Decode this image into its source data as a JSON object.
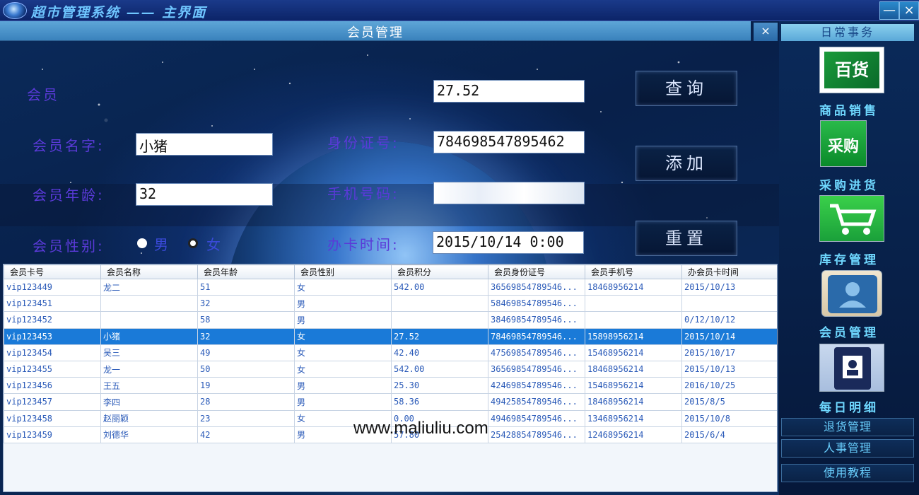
{
  "window": {
    "title": "超市管理系统 —— 主界面",
    "minimize": "—",
    "close": "×"
  },
  "panel": {
    "title": "会员管理",
    "close": "×"
  },
  "form": {
    "member_label": "会员",
    "member_value": "27.52",
    "name_label": "会员名字:",
    "name_value": "小猪",
    "id_label": "身份证号:",
    "id_value": "784698547895462",
    "age_label": "会员年龄:",
    "age_value": "32",
    "phone_label": "手机号码:",
    "phone_value": "",
    "gender_label": "会员性别:",
    "gender_male": "男",
    "gender_female": "女",
    "gender_selected": "男",
    "date_label": "办卡时间:",
    "date_value": "2015/10/14 0:00"
  },
  "buttons": {
    "query": "查询",
    "add": "添加",
    "reset": "重置"
  },
  "table": {
    "columns": [
      "会员卡号",
      "会员名称",
      "会员年龄",
      "会员性别",
      "会员积分",
      "会员身份证号",
      "会员手机号",
      "办会员卡时间"
    ],
    "selected_row": 3,
    "rows": [
      [
        "vip123449",
        "龙二",
        "51",
        "女",
        "542.00",
        "36569854789546...",
        "18468956214",
        "2015/10/13"
      ],
      [
        "vip123451",
        "",
        "32",
        "男",
        "",
        "58469854789546...",
        "",
        ""
      ],
      [
        "vip123452",
        "",
        "58",
        "男",
        "",
        "38469854789546...",
        "",
        "0/12/10/12"
      ],
      [
        "vip123453",
        "小猪",
        "32",
        "女",
        "27.52",
        "78469854789546...",
        "15898956214",
        "2015/10/14"
      ],
      [
        "vip123454",
        "吴三",
        "49",
        "女",
        "42.40",
        "47569854789546...",
        "15468956214",
        "2015/10/17"
      ],
      [
        "vip123455",
        "龙一",
        "50",
        "女",
        "542.00",
        "36569854789546...",
        "18468956214",
        "2015/10/13"
      ],
      [
        "vip123456",
        "王五",
        "19",
        "男",
        "25.30",
        "42469854789546...",
        "15468956214",
        "2016/10/25"
      ],
      [
        "vip123457",
        "李四",
        "28",
        "男",
        "58.36",
        "49425854789546...",
        "18468956214",
        "2015/8/5"
      ],
      [
        "vip123458",
        "赵丽颖",
        "23",
        "女",
        "0.00",
        "49469854789546...",
        "13468956214",
        "2015/10/8"
      ],
      [
        "vip123459",
        "刘德华",
        "42",
        "男",
        "57.80",
        "25428854789546...",
        "12468956214",
        "2015/6/4"
      ]
    ]
  },
  "watermark": "www.maliuliu.com",
  "sidebar": {
    "header": "日常事务",
    "items": [
      {
        "label": "商品销售",
        "icon": "goods-icon",
        "glyph": "百货"
      },
      {
        "label": "采购进货",
        "icon": "purchase-icon",
        "glyph": "采购"
      },
      {
        "label": "库存管理",
        "icon": "cart-icon",
        "glyph": ""
      },
      {
        "label": "会员管理",
        "icon": "member-icon",
        "glyph": ""
      },
      {
        "label": "每日明细",
        "icon": "daily-icon",
        "glyph": ""
      }
    ],
    "buttons": [
      "退货管理",
      "人事管理",
      "使用教程"
    ]
  }
}
